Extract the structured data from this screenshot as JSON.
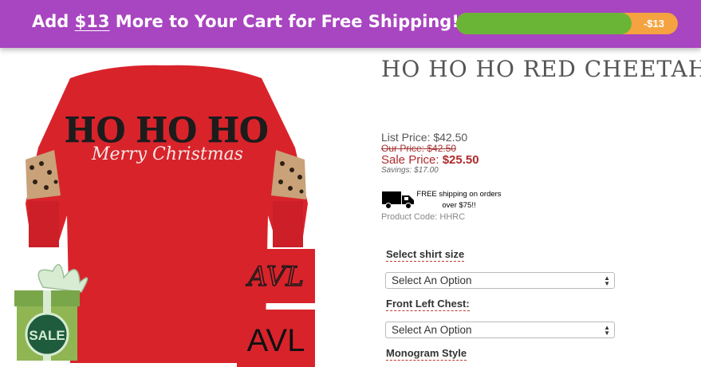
{
  "banner": {
    "text_before": "Add ",
    "amount": "$13",
    "text_after": " More to Your Cart for Free Shipping!",
    "progress_label": "-$13",
    "progress_fraction": 0.79,
    "colors": {
      "background": "#a845c0",
      "fill": "#6bb536",
      "remaining": "#f5a240"
    }
  },
  "product_image": {
    "icon": "red-cheetah-shirt",
    "shirt_text_line1": "HO HO HO",
    "shirt_text_line2": "Merry Christmas",
    "monogram_sample_1": "AVL",
    "monogram_sample_2": "AVL",
    "sale_tag": "SALE"
  },
  "product": {
    "title": "HO HO HO RED CHEETAH",
    "list_price": "List Price: $42.50",
    "our_price": "Our Price: $42.50",
    "sale_price_label": "Sale Price: ",
    "sale_price_value": "$25.50",
    "savings": "Savings: $17.00",
    "shipping_line1": "FREE shipping on orders",
    "shipping_line2": "over $75!!",
    "product_code": "Product Code: HHRC"
  },
  "options": {
    "size_label": "Select shirt size",
    "size_value": "Select An Option",
    "front_label": "Front Left Chest:",
    "front_value": "Select An Option",
    "monogram_label": "Monogram Style"
  }
}
